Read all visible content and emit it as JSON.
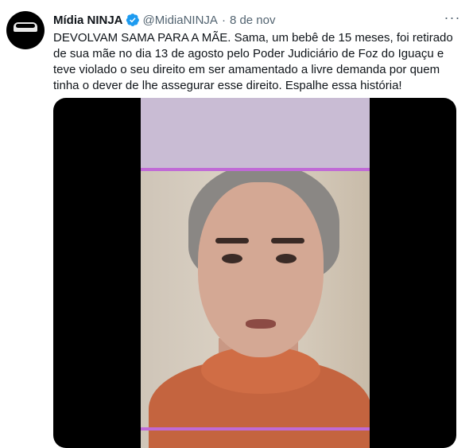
{
  "tweet": {
    "author_name": "Mídia NINJA",
    "handle": "@MidiaNINJA",
    "separator": "·",
    "date": "8 de nov",
    "more_label": "···",
    "text": "DEVOLVAM SAMA PARA A MÃE. Sama, um bebê de 15 meses, foi retirado de sua mãe no dia 13 de agosto pelo Poder Judiciário de Foz do Iguaçu e teve violado o seu direito em ser amamentado a livre demanda por quem tinha o dever de lhe assegurar esse direito. Espalhe essa história!"
  },
  "icons": {
    "avatar": "ninja-mask-avatar",
    "verified": "verified-badge-icon",
    "more": "more-options-icon"
  },
  "colors": {
    "text_primary": "#0f1419",
    "text_secondary": "#536471",
    "verified_blue": "#1d9bf0",
    "media_background": "#000000",
    "frame_lilac": "#c9bcd4",
    "frame_bar_purple": "#c06ad6"
  },
  "media": {
    "type": "video",
    "description_icon": "video-thumbnail"
  }
}
